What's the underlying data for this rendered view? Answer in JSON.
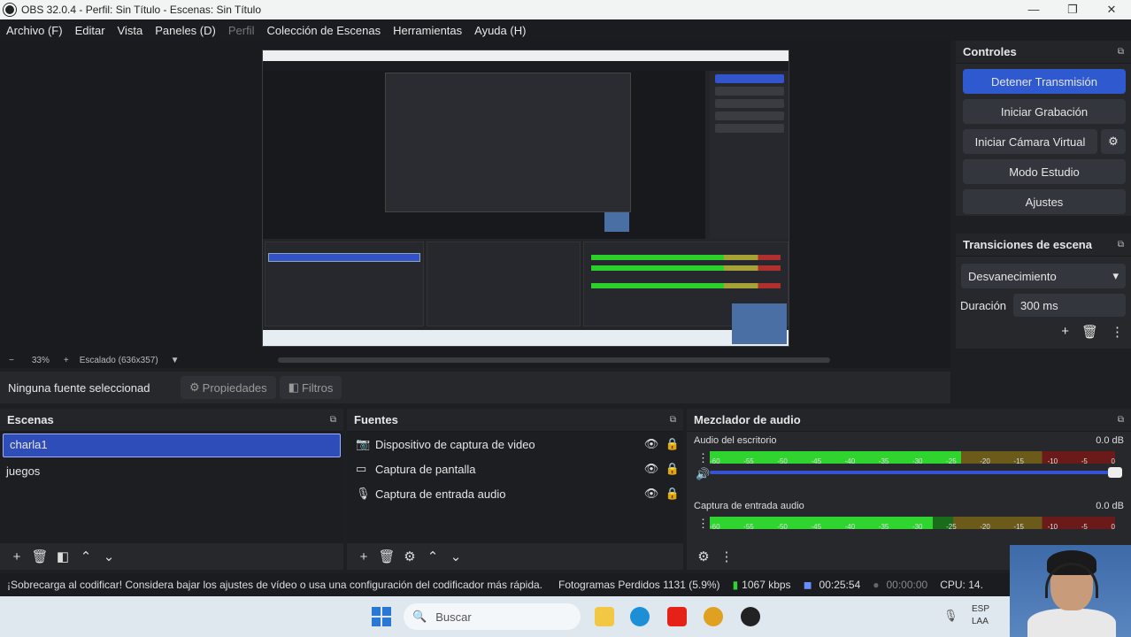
{
  "window": {
    "title": "OBS 32.0.4 - Perfil: Sin Título - Escenas: Sin Título",
    "minimize": "—",
    "maximize": "❐",
    "close": "✕"
  },
  "menu": [
    "Archivo (F)",
    "Editar",
    "Vista",
    "Paneles (D)",
    "Perfil",
    "Colección de Escenas",
    "Herramientas",
    "Ayuda (H)"
  ],
  "preview": {
    "zoom": "33%",
    "scaling": "Escalado (636x357)",
    "zoom_minus": "−",
    "zoom_plus": "+",
    "arrow": "▼"
  },
  "source_bar": {
    "label": "Ninguna fuente seleccionad",
    "properties": "Propiedades",
    "filters": "Filtros"
  },
  "controls": {
    "title": "Controles",
    "stop_stream": "Detener Transmisión",
    "start_recording": "Iniciar Grabación",
    "start_virtual_cam": "Iniciar Cámara Virtual",
    "studio_mode": "Modo Estudio",
    "settings": "Ajustes"
  },
  "transitions": {
    "title": "Transiciones de escena",
    "selected": "Desvanecimiento",
    "duration_label": "Duración",
    "duration_value": "300 ms"
  },
  "scenes": {
    "title": "Escenas",
    "items": [
      "charla1",
      "juegos"
    ]
  },
  "sources": {
    "title": "Fuentes",
    "items": [
      "Dispositivo de captura de video",
      "Captura de pantalla",
      "Captura de entrada audio"
    ]
  },
  "mixer": {
    "title": "Mezclador de audio",
    "channels": [
      {
        "name": "Audio del escritorio",
        "db": "0.0 dB",
        "level": 0.62
      },
      {
        "name": "Captura de entrada audio",
        "db": "0.0 dB",
        "level": 0.55
      }
    ],
    "ticks": [
      "-60",
      "-55",
      "-50",
      "-45",
      "-40",
      "-35",
      "-30",
      "-25",
      "-20",
      "-15",
      "-10",
      "-5",
      "0"
    ]
  },
  "status": {
    "warning": "¡Sobrecarga al codificar! Considera bajar los ajustes de vídeo o usa una configuración del codificador más rápida.",
    "dropped": "Fotogramas Perdidos 1131 (5.9%)",
    "bitrate": "1067 kbps",
    "stream_time": "00:25:54",
    "record_time": "00:00:00",
    "cpu": "CPU: 14."
  },
  "taskbar": {
    "search": "Buscar",
    "lang1": "ESP",
    "lang2": "LAA"
  },
  "colors": {
    "accent": "#2f59cf",
    "meter_green": "#2fd42f"
  }
}
